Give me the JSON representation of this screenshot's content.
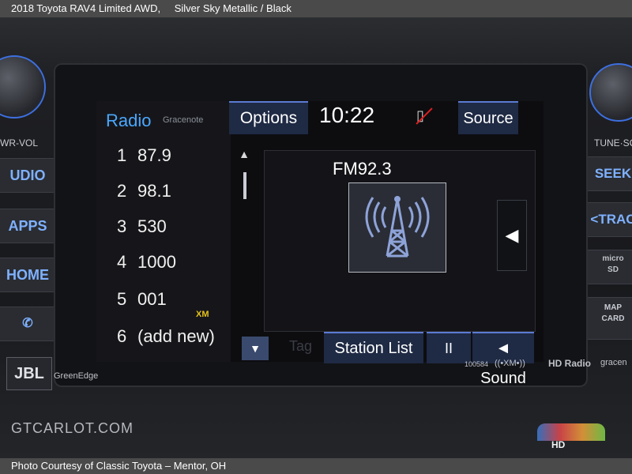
{
  "caption": {
    "title": "2018 Toyota RAV4 Limited AWD,",
    "color": "Silver Sky Metallic",
    "sep": "/",
    "interior": "Black",
    "credit": "Photo Courtesy of Classic Toyota – Mentor, OH"
  },
  "screen": {
    "title": "Radio",
    "provider": "Gracenote",
    "options_label": "Options",
    "clock": "10:22",
    "source_label": "Source",
    "station": "FM92.3",
    "tag_label": "Tag",
    "station_list_label": "Station List",
    "pause_label": "II",
    "sound_label": "Sound",
    "presets": [
      {
        "num": "1",
        "freq": "87.9"
      },
      {
        "num": "2",
        "freq": "98.1"
      },
      {
        "num": "3",
        "freq": "530"
      },
      {
        "num": "4",
        "freq": "1000"
      },
      {
        "num": "5",
        "freq": "001",
        "badge": "XM"
      },
      {
        "num": "6",
        "freq": "(add new)"
      }
    ]
  },
  "hardware": {
    "pwr_vol": "WR-VOL",
    "audio": "UDIO",
    "apps": "APPS",
    "home": "HOME",
    "tune_scroll": "TUNE·SCR",
    "seek": "SEEK",
    "track": "<TRAC",
    "map_card": "MAP\nCARD",
    "jbl": "JBL",
    "greenedge": "GreenEdge",
    "model": "100584",
    "xm_logo": "((•XM•))",
    "hd_radio": "HD Radio",
    "gracenote_logo": "gracen"
  },
  "watermark": "GTCARLOT.COM",
  "colors": {
    "accent_blue": "#4aa8ff",
    "button_bg": "#1f2a44",
    "xm_yellow": "#e6c21a",
    "mute_red": "#e02020"
  },
  "icons": [
    "phone-muted-icon",
    "radio-tower-icon",
    "speaker-icon",
    "scroll-up-icon",
    "scroll-down-icon",
    "arrow-left-icon",
    "phone-icon"
  ]
}
